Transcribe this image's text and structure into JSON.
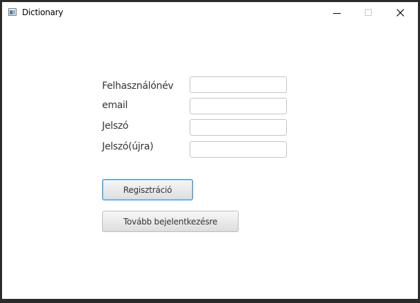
{
  "window": {
    "title": "Dictionary",
    "icon": "app-window-icon",
    "controls": [
      "minimize-icon",
      "maximize-icon",
      "close-icon"
    ]
  },
  "form": {
    "username_label": "Felhasználónév",
    "email_label": "email",
    "password_label": "Jelszó",
    "password_repeat_label": "Jelszó(újra)",
    "username_value": "",
    "email_value": "",
    "password_value": "",
    "password_repeat_value": ""
  },
  "buttons": {
    "register_label": "Regisztráció",
    "to_login_label": "Tovább bejelentkezésre"
  },
  "colors": {
    "focus_border": "#3e9ad6",
    "frame": "#2b2b2b"
  }
}
